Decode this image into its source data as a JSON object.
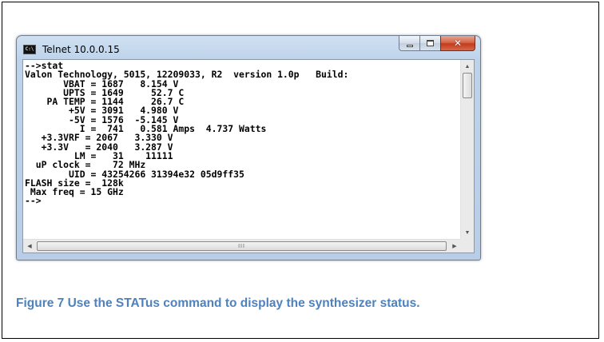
{
  "window": {
    "title": "Telnet 10.0.0.15",
    "icon": "console-app-icon",
    "icon_label": "C:\\"
  },
  "console": {
    "lines": [
      "-->stat",
      "Valon Technology, 5015, 12209033, R2  version 1.0p   Build:",
      "       VBAT = 1687   8.154 V",
      "       UPTS = 1649     52.7 C",
      "    PA TEMP = 1144     26.7 C",
      "        +5V = 3091   4.980 V",
      "        -5V = 1576  -5.145 V",
      "          I =  741   0.581 Amps  4.737 Watts",
      "   +3.3VRF = 2067   3.330 V",
      "   +3.3V   = 2040   3.287 V",
      "         LM =   31    11111",
      "  uP clock =    72 MHz",
      "        UID = 43254266 31394e32 05d9ff35",
      "FLASH size =  128k",
      " Max freq = 15 GHz",
      "-->"
    ]
  },
  "caption": {
    "text": "Figure 7  Use the STATus command to display the synthesizer status."
  },
  "colors": {
    "caption": "#4f81bd",
    "close_button": "#c43c1c",
    "frame_border": "#000000"
  }
}
